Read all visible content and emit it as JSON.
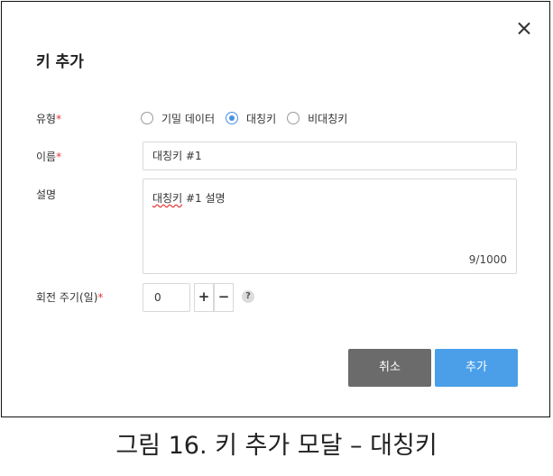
{
  "modal": {
    "title": "키 추가",
    "close_icon": "close-icon",
    "type_field": {
      "label": "유형",
      "required_mark": "*",
      "options": [
        {
          "label": "기밀 데이터",
          "selected": false
        },
        {
          "label": "대칭키",
          "selected": true
        },
        {
          "label": "비대칭키",
          "selected": false
        }
      ]
    },
    "name_field": {
      "label": "이름",
      "required_mark": "*",
      "value": "대칭키 #1"
    },
    "description_field": {
      "label": "설명",
      "value_word": "대칭키",
      "value_rest": " #1 설명",
      "counter": "9/1000"
    },
    "rotation_field": {
      "label": "회전 주기(일)",
      "required_mark": "*",
      "value": "0",
      "plus_label": "+",
      "minus_label": "−",
      "help_label": "?"
    },
    "buttons": {
      "cancel": "취소",
      "add": "추가"
    }
  },
  "caption": "그림 16. 키 추가 모달 – 대칭키",
  "colors": {
    "primary": "#4a9fe8",
    "cancel": "#6b6b6b",
    "required": "#e53935",
    "radio_selected": "#4a90e2"
  }
}
